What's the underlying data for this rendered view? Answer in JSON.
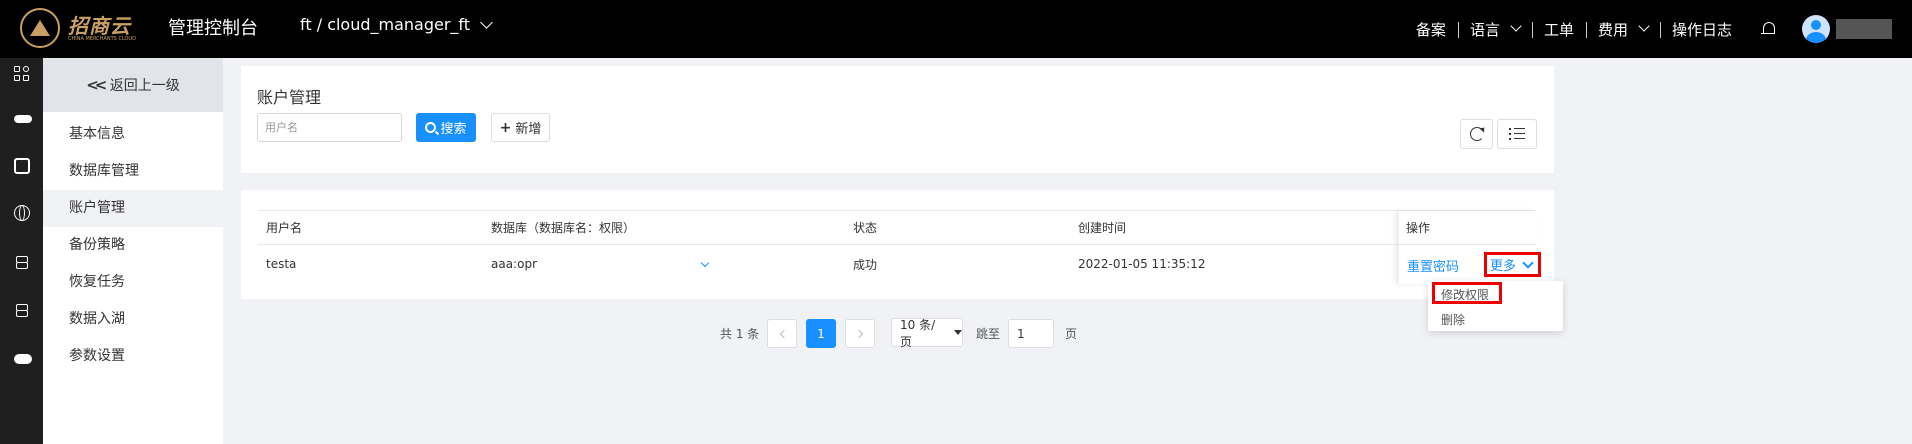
{
  "brand": {
    "logo_text": "招商云",
    "logo_sub": "CHINA MERCHANTS CLOUD",
    "console_title": "管理控制台",
    "gold_color": "#c9a063"
  },
  "project": {
    "name": "ft / cloud_manager_ft"
  },
  "topnav": {
    "filing": "备案",
    "language": "语言",
    "ticket": "工单",
    "cost": "费用",
    "oplog": "操作日志"
  },
  "subnav": {
    "back": "返回上一级",
    "items": [
      {
        "label": "基本信息"
      },
      {
        "label": "数据库管理"
      },
      {
        "label": "账户管理"
      },
      {
        "label": "备份策略"
      },
      {
        "label": "恢复任务"
      },
      {
        "label": "数据入湖"
      },
      {
        "label": "参数设置"
      }
    ]
  },
  "main": {
    "title": "账户管理",
    "search_placeholder": "用户名",
    "search_label": "搜索",
    "add_label": "新增"
  },
  "table": {
    "columns": [
      "用户名",
      "数据库（数据库名：权限）",
      "状态",
      "创建时间",
      "操作"
    ],
    "rows": [
      {
        "username": "testa",
        "database": "aaa:opr",
        "status": "成功",
        "created": "2022-01-05 11:35:12",
        "reset": "重置密码",
        "more": "更多"
      }
    ]
  },
  "dropdown": {
    "modify": "修改权限",
    "delete": "删除"
  },
  "pagination": {
    "total": "共 1 条",
    "current": "1",
    "page_size": "10 条/页",
    "jump": "跳至",
    "jump_value": "1",
    "page_suffix": "页"
  },
  "colors": {
    "primary": "#1890ff",
    "highlight": "#e00000",
    "topbar": "#000000"
  }
}
